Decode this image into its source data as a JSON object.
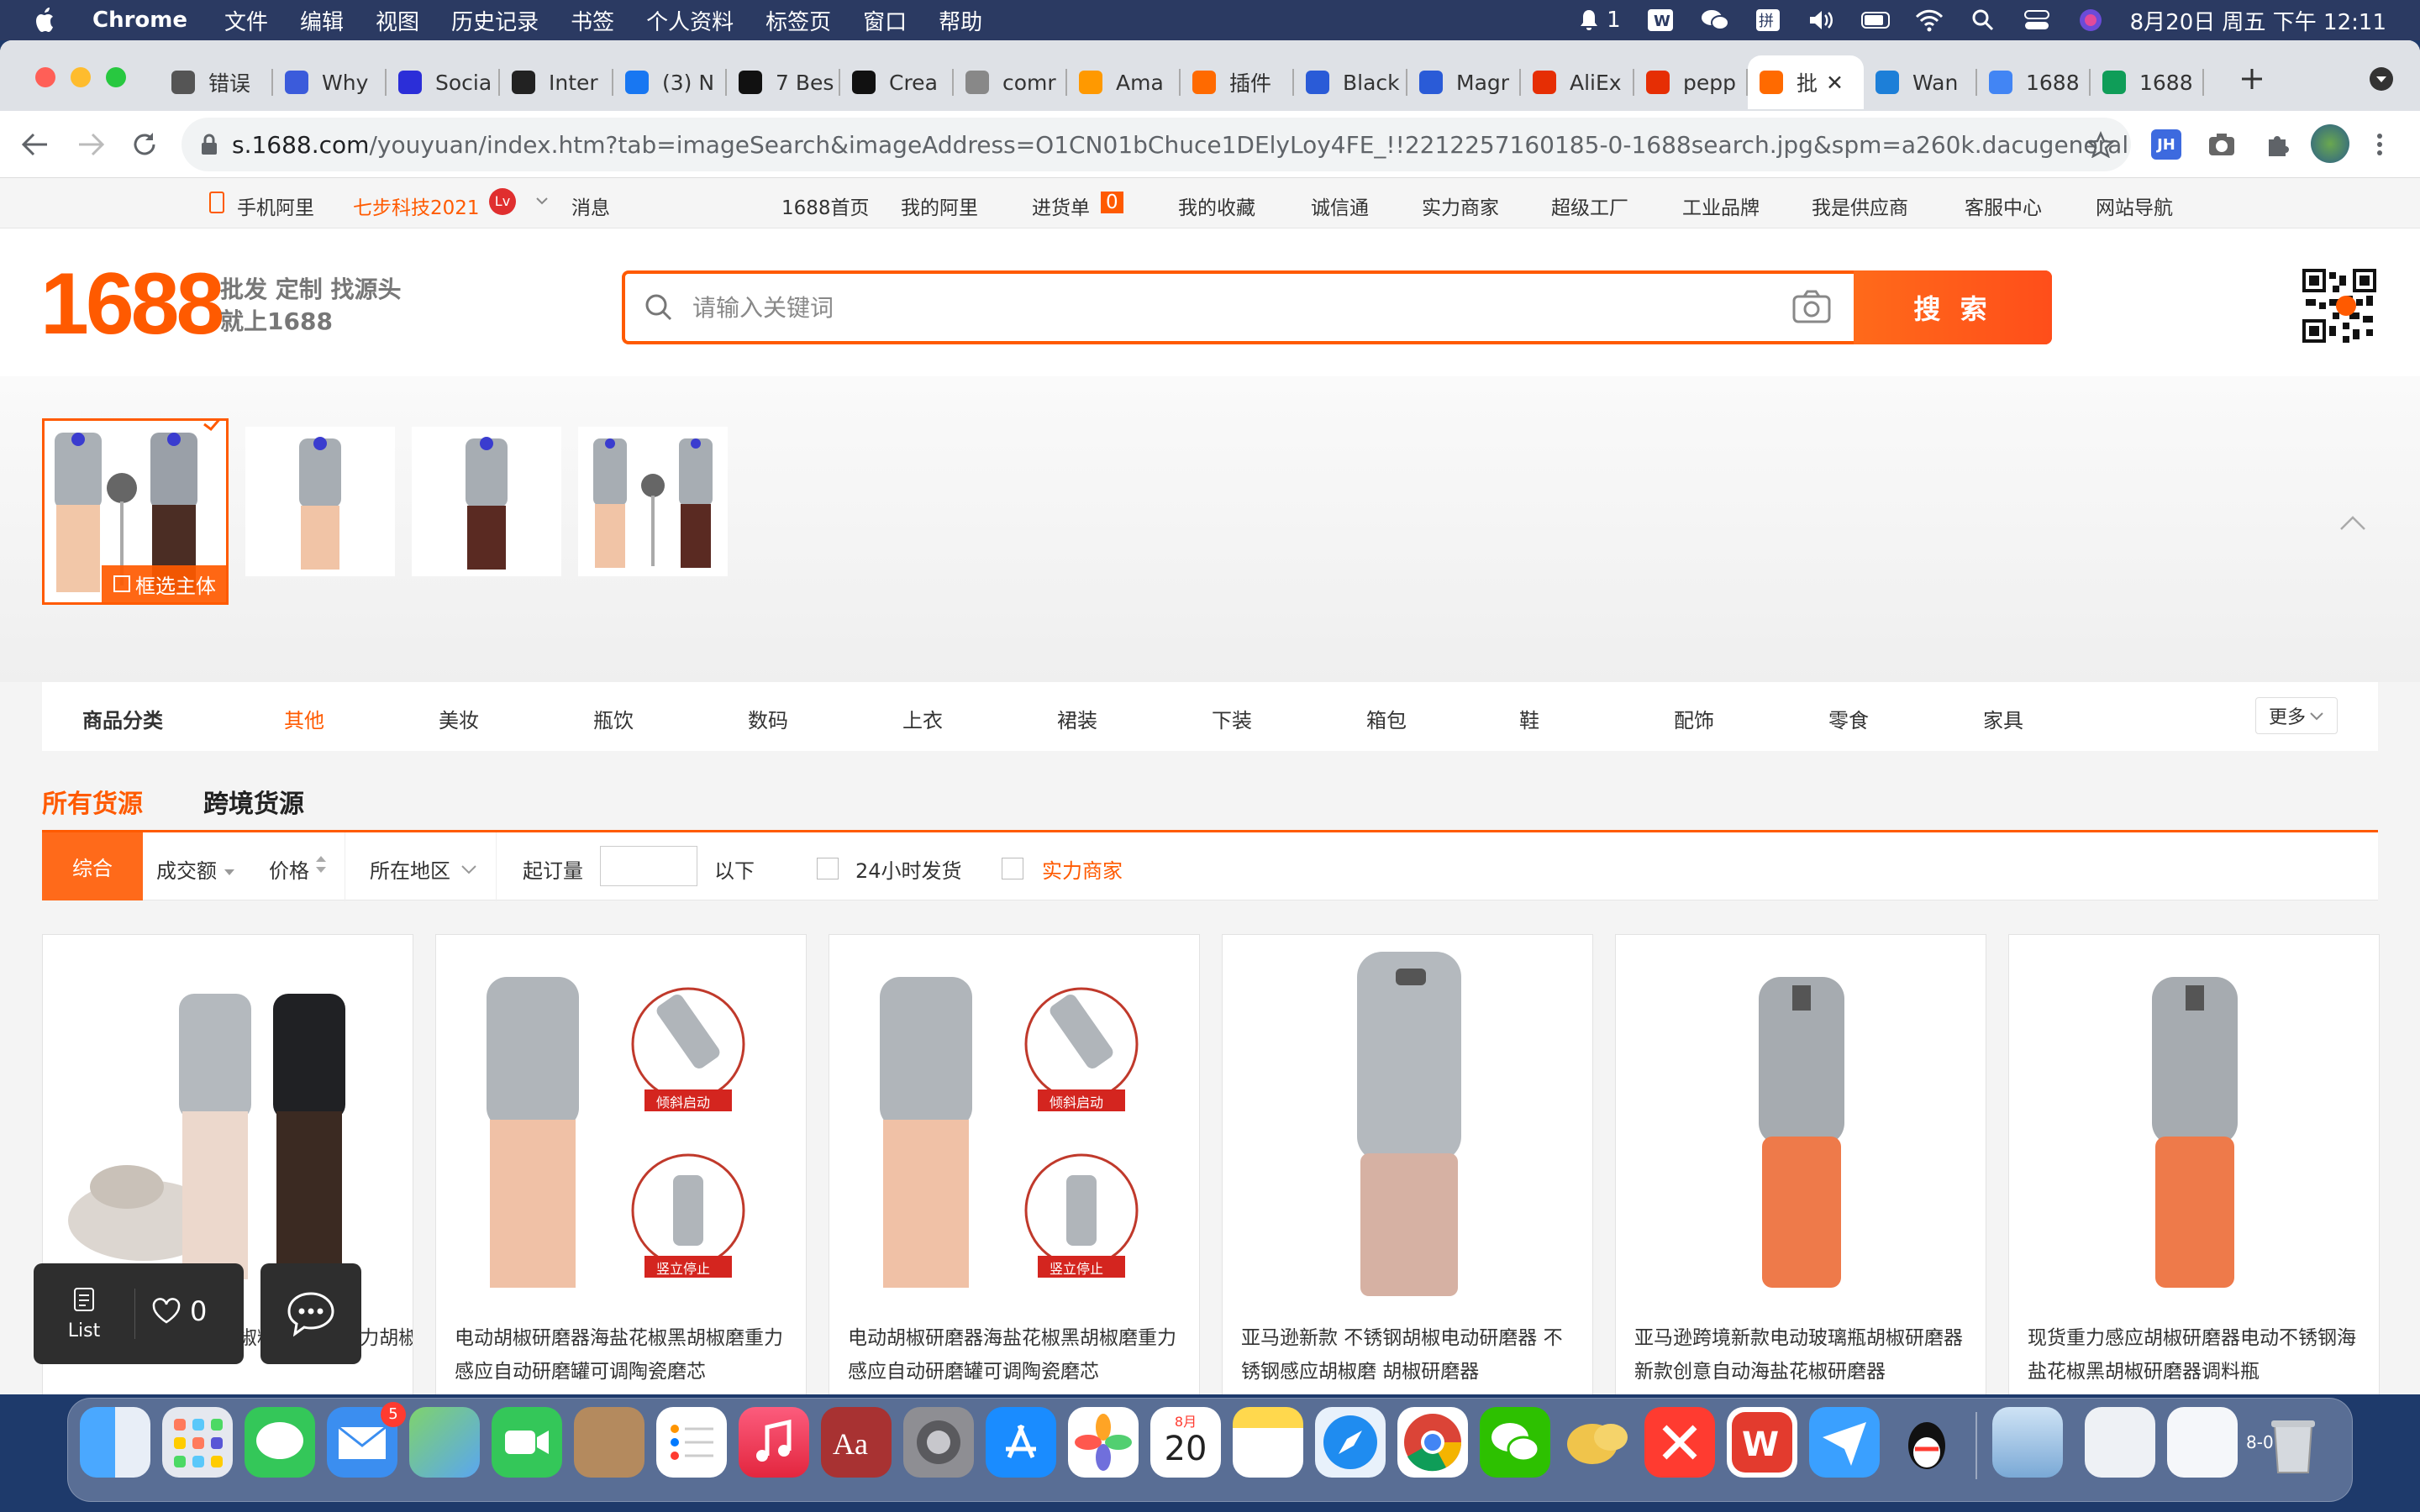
{
  "menubar": {
    "app": "Chrome",
    "items": [
      "文件",
      "编辑",
      "视图",
      "历史记录",
      "书签",
      "个人资料",
      "标签页",
      "窗口",
      "帮助"
    ],
    "notification_count": "1",
    "datetime": "8月20日 周五 下午 12:11"
  },
  "tabs": [
    {
      "label": "错误",
      "icon": "globe-icon"
    },
    {
      "label": "Why",
      "icon": "reload-icon"
    },
    {
      "label": "Socia",
      "icon": "social-icon"
    },
    {
      "label": "Inter",
      "icon": "puzzle-icon"
    },
    {
      "label": "(3) N",
      "icon": "facebook-icon"
    },
    {
      "label": "7 Bes",
      "icon": "medium-icon"
    },
    {
      "label": "Crea",
      "icon": "tiktok-icon"
    },
    {
      "label": "comr",
      "icon": "chrome-icon"
    },
    {
      "label": "Ama",
      "icon": "amazon-icon"
    },
    {
      "label": "插件",
      "icon": "plugin-icon"
    },
    {
      "label": "Black",
      "icon": "bar-icon"
    },
    {
      "label": "Magr",
      "icon": "bar-icon"
    },
    {
      "label": "AliEx",
      "icon": "aliexpress-icon"
    },
    {
      "label": "pepp",
      "icon": "aliexpress-icon"
    },
    {
      "label": "批",
      "icon": "1688-icon",
      "active": true
    },
    {
      "label": "Wan",
      "icon": "cb-icon"
    },
    {
      "label": "1688",
      "icon": "doc-icon"
    },
    {
      "label": "1688",
      "icon": "drive-icon"
    }
  ],
  "omnibox": {
    "domain": "s.1688.com",
    "rest": "/youyuan/index.htm?tab=imageSearch&imageAddress=O1CN01bChuce1DElyLoy4FE_!!2212257160185-0-1688search.jpg&spm=a260k.dacugeneral.se..."
  },
  "topnav": {
    "mobile": "手机阿里",
    "user": "七步科技2021",
    "messages": "消息",
    "links": [
      "1688首页",
      "我的阿里",
      "进货单",
      "我的收藏",
      "诚信通",
      "实力商家",
      "超级工厂",
      "工业品牌",
      "我是供应商",
      "客服中心",
      "网站导航"
    ],
    "cart_count": "0"
  },
  "header": {
    "logo": "1688",
    "slogan_line1": "批发 定制 找源头",
    "slogan_line2": "就上1688",
    "search_placeholder": "请输入关键词",
    "search_button": "搜 索"
  },
  "thumbs": {
    "badge": "框选主体"
  },
  "categories": {
    "label": "商品分类",
    "items": [
      "其他",
      "美妆",
      "瓶饮",
      "数码",
      "上衣",
      "裙装",
      "下装",
      "箱包",
      "鞋",
      "配饰",
      "零食",
      "家具"
    ],
    "more": "更多"
  },
  "source_tabs": [
    "所有货源",
    "跨境货源"
  ],
  "filters": {
    "sort_all": "综合",
    "volume": "成交额",
    "price": "价格",
    "region": "所在地区",
    "moq": "起订量",
    "moq_suffix": "以下",
    "ship24": "24小时发货",
    "strong": "实力商家"
  },
  "products": [
    {
      "title": "...椒粉研磨器 重力胡椒磨"
    },
    {
      "title": "电动胡椒研磨器海盐花椒黑胡椒磨重力感应自动研磨罐可调陶瓷磨芯",
      "tag1": "倾斜启动",
      "tag2": "竖立停止"
    },
    {
      "title": "电动胡椒研磨器海盐花椒黑胡椒磨重力感应自动研磨罐可调陶瓷磨芯",
      "tag1": "倾斜启动",
      "tag2": "竖立停止"
    },
    {
      "title": "亚马逊新款 不锈钢胡椒电动研磨器 不锈钢感应胡椒磨 胡椒研磨器"
    },
    {
      "title": "亚马逊跨境新款电动玻璃瓶胡椒研磨器新款创意自动海盐花椒研磨器"
    },
    {
      "title": "现货重力感应胡椒研磨器电动不锈钢海盐花椒黑胡椒研磨器调料瓶"
    }
  ],
  "float": {
    "list": "List",
    "likes": "0"
  },
  "dock": {
    "calendar_month": "8月",
    "calendar_day": "20",
    "mail_badge": "5"
  }
}
